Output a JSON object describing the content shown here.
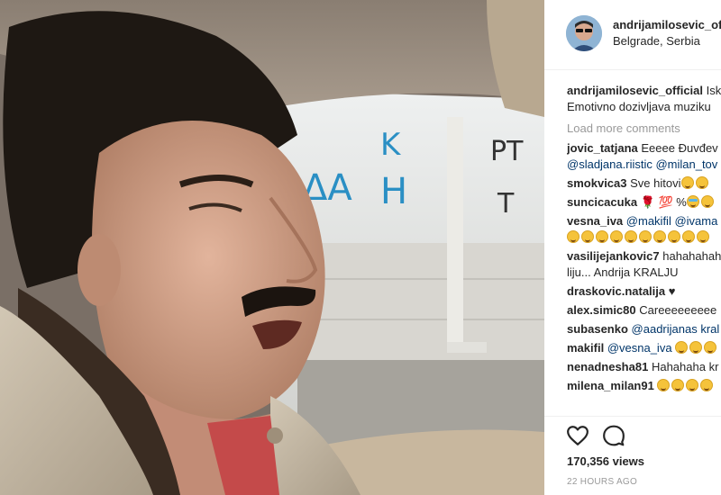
{
  "post": {
    "author": "andrijamilosevic_official",
    "location": "Belgrade, Serbia",
    "caption_user": "andrijamilosevic_official",
    "caption_text_line1": "Isk",
    "caption_text_line2": "Emotivno dozivljava muziku",
    "load_more": "Load more comments",
    "views": "170,356 views",
    "time": "22 HOURS AGO"
  },
  "video": {
    "graffiti_k": "K",
    "graffiti_a": "ΔΑ",
    "graffiti_h": "H",
    "graffiti_pt": "PT",
    "graffiti_t": "T"
  },
  "comments": [
    {
      "user": "jovic_tatjana",
      "text": "Eeeee Đuvđev",
      "line2": "@sladjana.riistic @milan_tov"
    },
    {
      "user": "smokvica3",
      "text": "Sve hitovi",
      "emoji": 2
    },
    {
      "user": "suncicacuka",
      "text": "",
      "emoji": 2,
      "prefix": "🌹 💯 %"
    },
    {
      "user": "vesna_iva",
      "text": "@makifil @ivama",
      "emoji_line2": 10
    },
    {
      "user": "vasilijejankovic7",
      "text": "hahahahah",
      "line2": "liju... Andrija KRALJU"
    },
    {
      "user": "draskovic.natalija",
      "text": "♥"
    },
    {
      "user": "alex.simic80",
      "text": "Careeeeeeeee"
    },
    {
      "user": "subasenko",
      "text": "@aadrijanas kral"
    },
    {
      "user": "makifil",
      "text": "@vesna_iva",
      "emoji": 3
    },
    {
      "user": "nenadnesha81",
      "text": "Hahahaha kr"
    },
    {
      "user": "milena_milan91",
      "text": "",
      "emoji": 4
    }
  ],
  "icons": {
    "heart": "heart-icon",
    "comment": "comment-icon"
  }
}
